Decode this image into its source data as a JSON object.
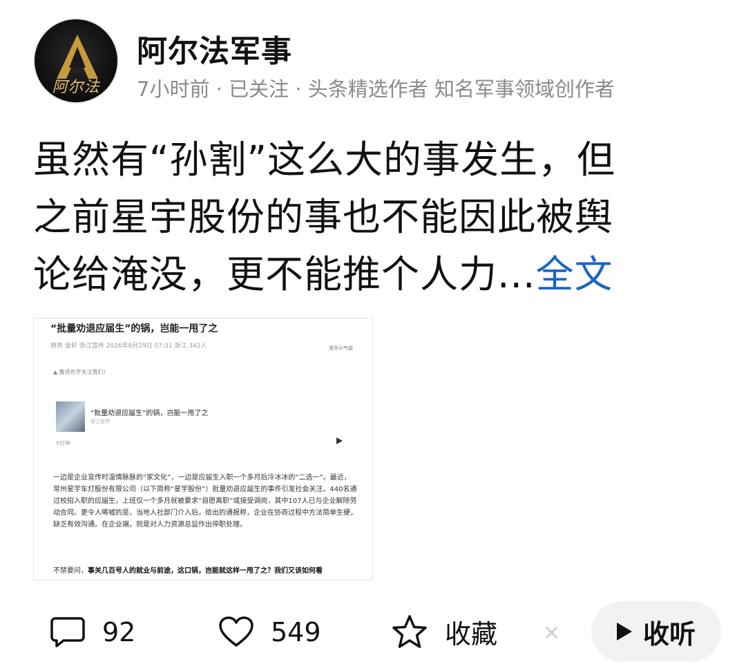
{
  "author": {
    "name": "阿尔法军事",
    "avatar_text": "阿尔法",
    "meta": "7小时前 · 已关注 · 头条精选作者 知名军事领域创作者"
  },
  "post": {
    "line1": "虽然有“孙割”这么大的事发生，但",
    "line2": "之前星宇股份的事也不能因此被舆",
    "line3_text": "论给淹没，更不能推个人力...",
    "more_label": "全文"
  },
  "article_image": {
    "title": "“批量劝退应届生”的锅，岂能一甩了之",
    "meta": "商务  金轩  浙江宣传  2026年8月29日 07:31  浙江  342人",
    "meta_right": "关中小气说",
    "note": "▲ 戴佰色字关注我们!",
    "card_title": "“批量劝退应届生”的锅，岂能一甩了之",
    "card_sub": "浙江宣传",
    "duration": "9分钟",
    "paragraph": "一边是企业宣传时温情脉脉的“家文化”，一边是应届生入职一个多月后冷冰冰的“二选一”。最近，常州星宇车灯股份有限公司（以下简称“星宇股份”）批量劝退应届生的事件引发社会关注。440名通过校招入职的应届生，上班仅一个多月就被要求“自愿离职”或接受调岗，其中107人已与企业解除劳动合同。更令人唏嘘的是，当地人社部门介入后，给出的通报称，企业在协商过程中方法简单生硬，缺乏有效沟通。在企业端，则是对人力资源总监作出停职处理。",
    "last_prefix": "不禁要问，",
    "last_bold": "事关几百号人的就业与前途，这口锅，岂能就这样一甩了之？我们又该如何看"
  },
  "actions": {
    "comment_count": "92",
    "like_count": "549",
    "favorite_label": "收藏",
    "close_symbol": "×",
    "listen_label": "收听"
  }
}
